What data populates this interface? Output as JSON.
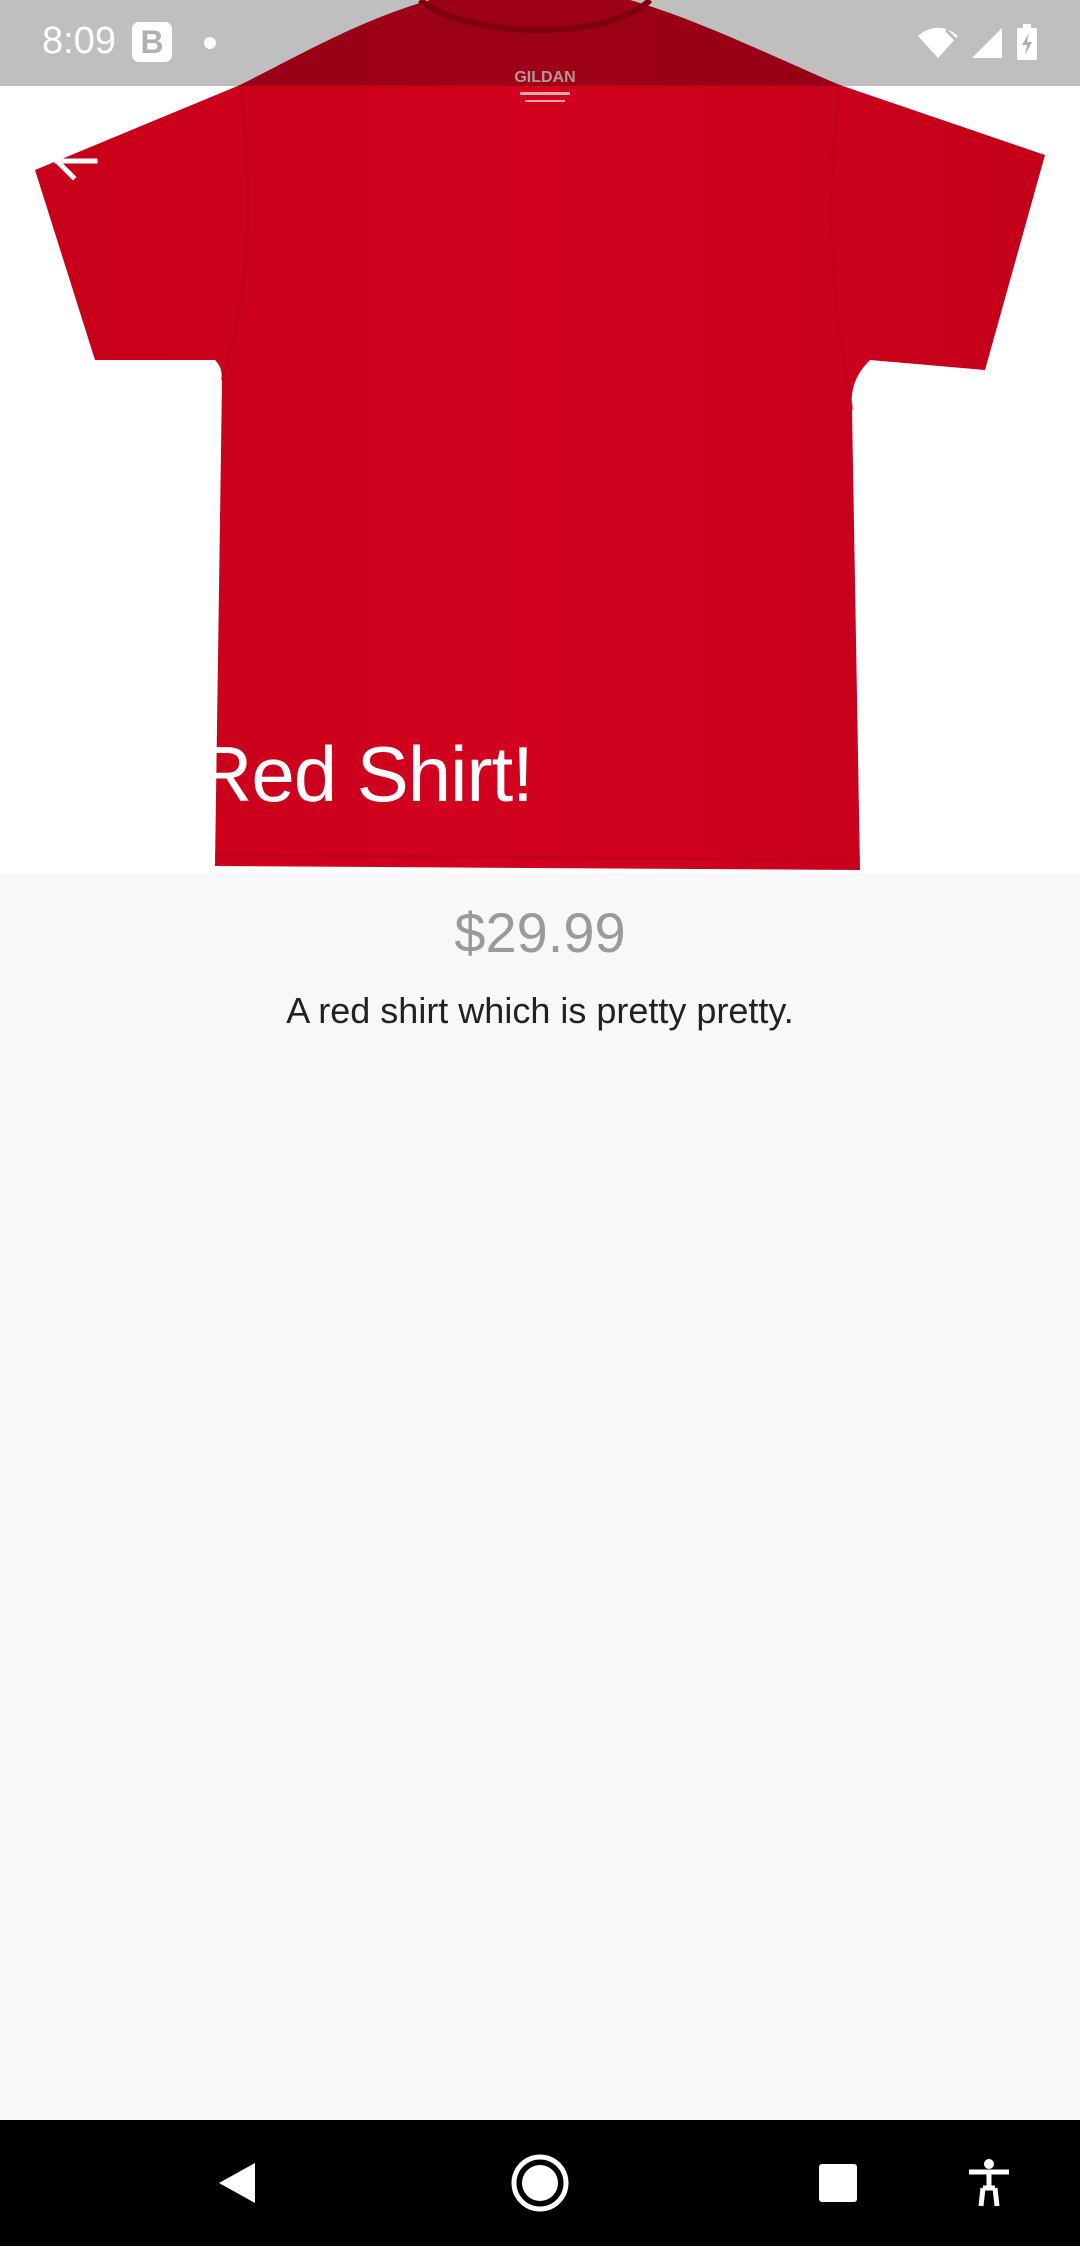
{
  "status_bar": {
    "time": "8:09",
    "badge": "B"
  },
  "product": {
    "title": "Red Shirt!",
    "price": "$29.99",
    "description": "A red shirt which is pretty pretty.",
    "brand_tag": "GILDAN",
    "shirt_color": "#d0021b"
  },
  "nav": {
    "back_icon": "back-arrow-icon",
    "system_back": "triangle-back-icon",
    "system_home": "circle-home-icon",
    "system_recents": "square-recents-icon",
    "accessibility": "accessibility-icon"
  },
  "colors": {
    "background": "#f8f8fa",
    "price": "#9a9a9a",
    "description": "#222222"
  }
}
